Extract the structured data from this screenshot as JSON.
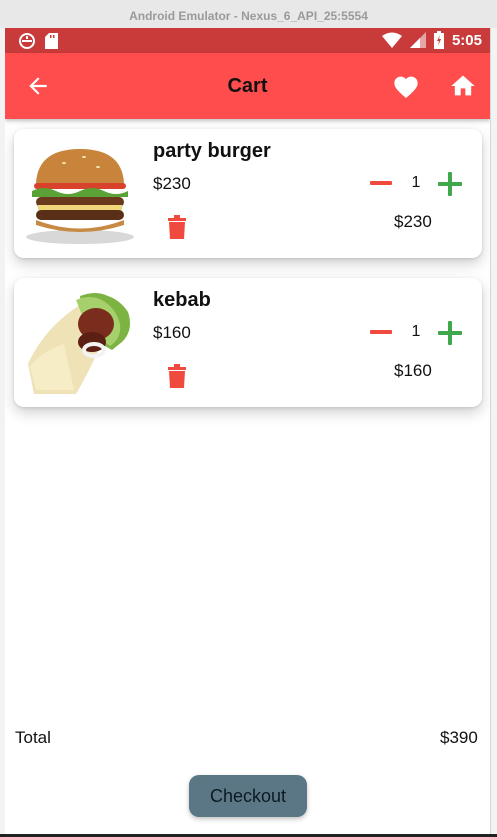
{
  "emulator": {
    "title": "Android Emulator - Nexus_6_API_25:5554"
  },
  "statusbar": {
    "time": "5:05",
    "icons": [
      "sync-icon",
      "sd-card-icon",
      "wifi-icon",
      "signal-icon",
      "battery-icon"
    ]
  },
  "appbar": {
    "title": "Cart",
    "back_icon": "arrow-back-icon",
    "actions": [
      "heart-icon",
      "home-icon"
    ],
    "color": "#ff4d4d"
  },
  "cart": {
    "items": [
      {
        "name": "party burger",
        "price": "$230",
        "quantity": "1",
        "subtotal": "$230",
        "image": "burger-image"
      },
      {
        "name": "kebab",
        "price": "$160",
        "quantity": "1",
        "subtotal": "$160",
        "image": "kebab-wrap-image"
      }
    ]
  },
  "summary": {
    "total_label": "Total",
    "total_value": "$390"
  },
  "checkout": {
    "label": "Checkout",
    "color": "#5b7786"
  },
  "colors": {
    "statusbar": "#c93b3b",
    "minus": "#f04a3f",
    "plus": "#3fa84b",
    "trash": "#f04a3f"
  }
}
